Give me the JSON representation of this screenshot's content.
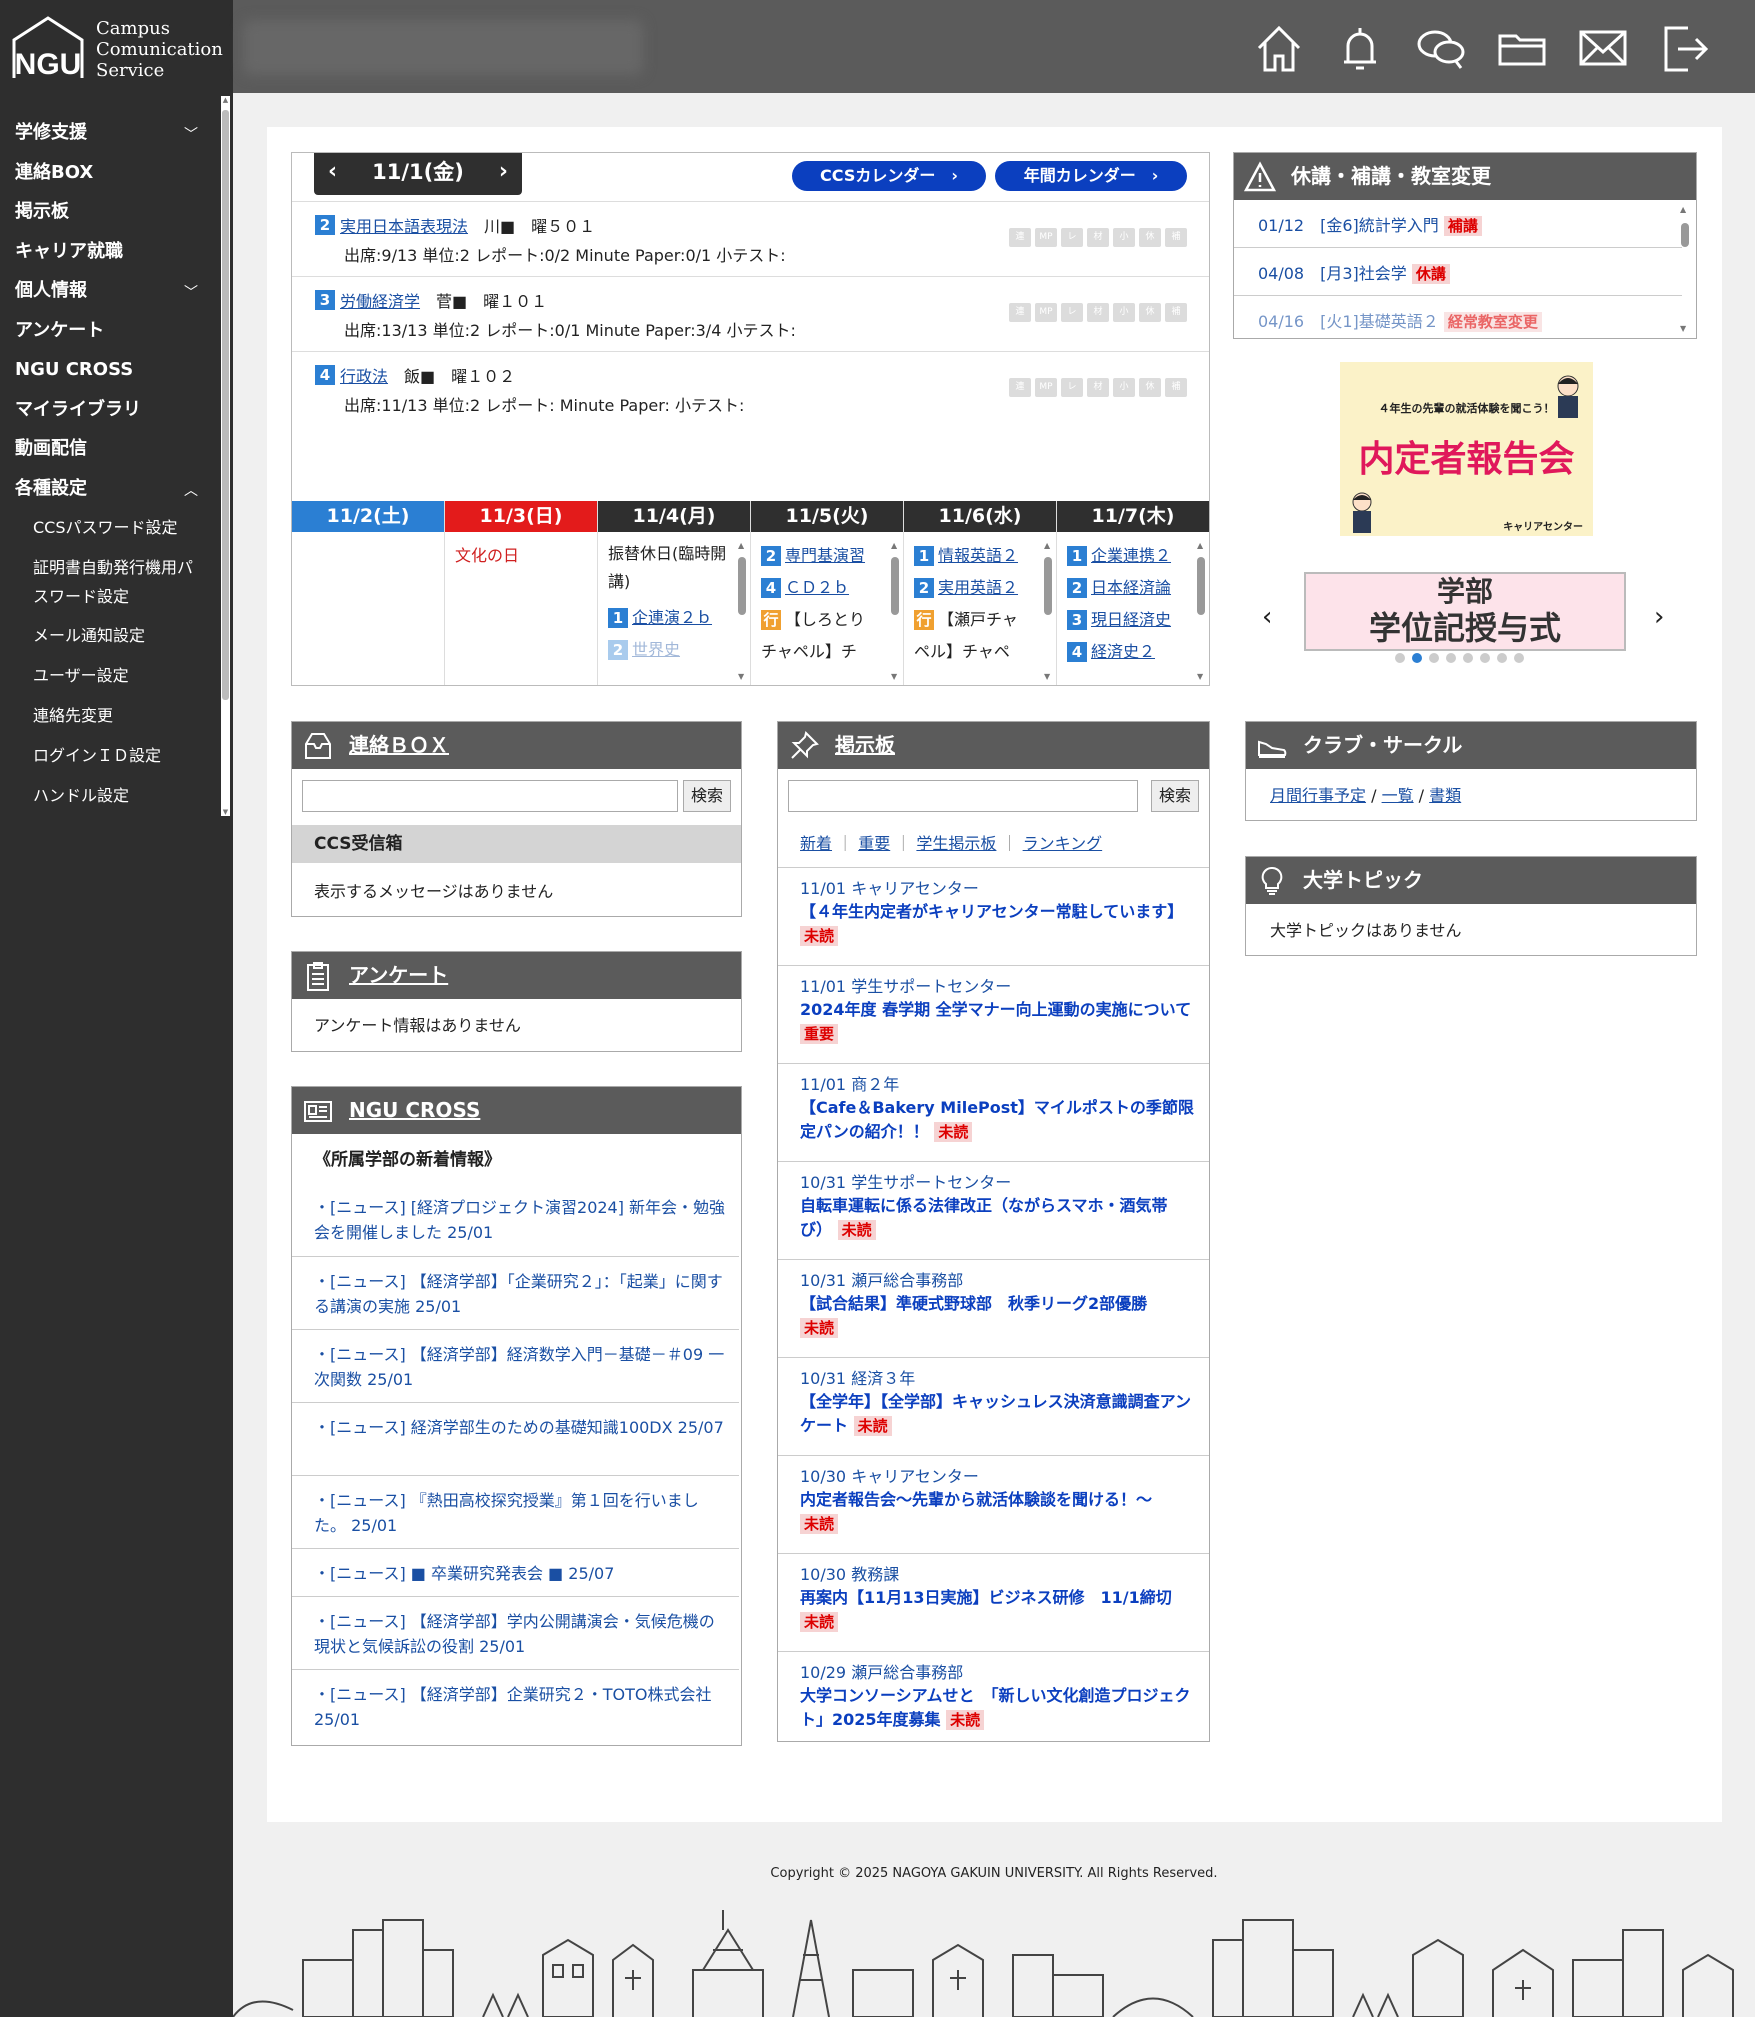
{
  "logo": {
    "line1": "Campus",
    "line2": "Comunication",
    "line3": "Service"
  },
  "nav": {
    "items": [
      "学修支援",
      "連絡BOX",
      "掲示板",
      "キャリア就職",
      "個人情報",
      "アンケート",
      "NGU CROSS",
      "マイライブラリ",
      "動画配信",
      "各種設定"
    ],
    "sub": [
      "CCSパスワード設定",
      "証明書自動発行機用パスワード設定",
      "メール通知設定",
      "ユーザー設定",
      "連絡先変更",
      "ログインＩＤ設定",
      "ハンドル設定"
    ]
  },
  "header_icons": [
    "home-icon",
    "bell-icon",
    "chat-icon",
    "folder-icon",
    "mail-icon",
    "logout-icon"
  ],
  "schedule": {
    "date": "11/1(金)",
    "ccs_calendar": "CCSカレンダー",
    "year_calendar": "年間カレンダー",
    "courses": [
      {
        "period": "2",
        "name": "実用日本語表現法",
        "teacher": "川■",
        "room": "曜５０１",
        "detail": "出席:9/13 単位:2 レポート:0/2 Minute Paper:0/1 小テスト:"
      },
      {
        "period": "3",
        "name": "労働経済学",
        "teacher": "菅■",
        "room": "曜１０１",
        "detail": "出席:13/13 単位:2 レポート:0/1 Minute Paper:3/4 小テスト:"
      },
      {
        "period": "4",
        "name": "行政法",
        "teacher": "飯■",
        "room": "曜１０２",
        "detail": "出席:11/13 単位:2 レポート: Minute Paper: 小テスト:"
      }
    ],
    "tags": [
      "連",
      "MP",
      "レ",
      "材",
      "小",
      "休",
      "補"
    ],
    "week": [
      {
        "label": "11/2(土)",
        "color": "#2b7fd3",
        "items": []
      },
      {
        "label": "11/3(日)",
        "color": "#e31b1b",
        "holiday": "文化の日",
        "items": []
      },
      {
        "label": "11/4(月)",
        "color": "#2f2f2f",
        "note": "振替休日(臨時開講)",
        "items": [
          {
            "n": "1",
            "t": "企連演２ｂ"
          },
          {
            "n": "2",
            "t": "世界史"
          }
        ]
      },
      {
        "label": "11/5(火)",
        "color": "#2f2f2f",
        "items": [
          {
            "n": "2",
            "t": "専門基演習"
          },
          {
            "n": "4",
            "t": "ＣＤ２ｂ"
          },
          {
            "n": "行",
            "t": "【しろとり"
          },
          {
            "n": "",
            "t": "チャペル】チ"
          }
        ]
      },
      {
        "label": "11/6(水)",
        "color": "#2f2f2f",
        "items": [
          {
            "n": "1",
            "t": "情報英語２"
          },
          {
            "n": "2",
            "t": "実用英語２"
          },
          {
            "n": "行",
            "t": "【瀬戸チャ"
          },
          {
            "n": "",
            "t": "ペル】チャペ"
          }
        ]
      },
      {
        "label": "11/7(木)",
        "color": "#2f2f2f",
        "items": [
          {
            "n": "1",
            "t": "企業連携２"
          },
          {
            "n": "2",
            "t": "日本経済論"
          },
          {
            "n": "3",
            "t": "現日経済史"
          },
          {
            "n": "4",
            "t": "経済史２"
          }
        ]
      }
    ]
  },
  "cancellations": {
    "title": "休講・補講・教室変更",
    "items": [
      {
        "text": "01/12　[金6]統計学入門",
        "tag": "補講"
      },
      {
        "text": "04/08　[月3]社会学",
        "tag": "休講"
      },
      {
        "text": "04/16　[火1]基礎英語２",
        "tag": "経常教室変更"
      }
    ]
  },
  "banners": {
    "b1_top": "４年生の先輩の就活体験を聞こう！",
    "b1_main": "内定者報告会",
    "b1_sub": "キャリアセンター",
    "b2_line1": "学部",
    "b2_line2": "学位記授与式"
  },
  "renraku": {
    "title": "連絡ＢＯＸ",
    "search": "検索",
    "inbox": "CCS受信箱",
    "empty": "表示するメッセージはありません"
  },
  "survey": {
    "title": "アンケート",
    "empty": "アンケート情報はありません"
  },
  "ngucross": {
    "title": "NGU CROSS",
    "heading": "《所属学部の新着情報》",
    "items": [
      "・[ニュース] [経済プロジェクト演習2024] 新年会・勉強会を開催しました 25/01",
      "・[ニュース] 【経済学部】「企業研究２」：「起業」に関する講演の実施 25/01",
      "・[ニュース] 【経済学部】経済数学入門－基礎－＃09 一次関数 25/01",
      "・[ニュース] 経済学部生のための基礎知識100DX 25/07",
      "・[ニュース] 『熱田高校探究授業』第１回を行いました。 25/01",
      "・[ニュース] ■ 卒業研究発表会 ■ 25/07",
      "・[ニュース] 【経済学部】学内公開講演会・気候危機の現状と気候訴訟の役割 25/01",
      "・[ニュース] 【経済学部】企業研究２・TOTO株式会社 25/01"
    ]
  },
  "bulletin": {
    "title": "掲示板",
    "search": "検索",
    "filters": [
      "新着",
      "重要",
      "学生掲示板",
      "ランキング"
    ],
    "items": [
      {
        "date": "11/01 キャリアセンター",
        "title": "【４年生内定者がキャリアセンター常駐しています】",
        "tag": "未読"
      },
      {
        "date": "11/01 学生サポートセンター",
        "title": "2024年度 春学期 全学マナー向上運動の実施について",
        "tag": "重要"
      },
      {
        "date": "11/01 商２年",
        "title": "【Cafe＆Bakery MilePost】マイルポストの季節限定パンの紹介！！",
        "tag": "未読"
      },
      {
        "date": "10/31 学生サポートセンター",
        "title": "自転車運転に係る法律改正（ながらスマホ・酒気帯び）",
        "tag": "未読"
      },
      {
        "date": "10/31 瀬戸総合事務部",
        "title": "【試合結果】準硬式野球部　秋季リーグ2部優勝",
        "tag": "未読"
      },
      {
        "date": "10/31 経済３年",
        "title": "【全学年】【全学部】キャッシュレス決済意識調査アンケート",
        "tag": "未読"
      },
      {
        "date": "10/30 キャリアセンター",
        "title": "内定者報告会～先輩から就活体験談を聞ける！～",
        "tag": "未読"
      },
      {
        "date": "10/30 教務課",
        "title": "再案内【11月13日実施】ビジネス研修　11/1締切",
        "tag": "未読"
      },
      {
        "date": "10/29 瀬戸総合事務部",
        "title": "大学コンソーシアムせと　「新しい文化創造プロジェクト」2025年度募集",
        "tag": "未読"
      }
    ]
  },
  "club": {
    "title": "クラブ・サークル",
    "links": [
      "月間行事予定",
      "一覧",
      "書類"
    ]
  },
  "topic": {
    "title": "大学トピック",
    "empty": "大学トピックはありません"
  },
  "copyright": "Copyright © 2025 NAGOYA GAKUIN UNIVERSITY. All Rights Reserved."
}
